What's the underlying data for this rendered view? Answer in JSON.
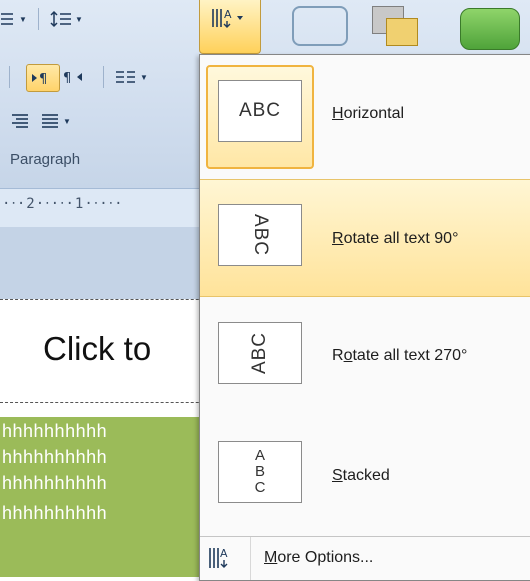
{
  "ribbon": {
    "group_label": "Paragraph",
    "ruler_text": "·‧·2·‧·‧·1·‧·‧·"
  },
  "slide": {
    "title_placeholder": "Click to",
    "green_lines": [
      "hhhhhhhhhh",
      "hhhhhhhhhh",
      "hhhhhhhhhh",
      "hhhhhhhhhh"
    ]
  },
  "text_direction_menu": {
    "items": [
      {
        "thumb": "ABC",
        "label_u": "H",
        "label_rest": "orizontal",
        "selected": true
      },
      {
        "thumb": "ABC",
        "label_u": "R",
        "label_rest": "otate all text 90°",
        "highlighted": true
      },
      {
        "thumb": "ABC",
        "label_pre": "R",
        "label_u": "o",
        "label_rest": "tate all text 270°"
      },
      {
        "thumb": "ABC",
        "label_u": "S",
        "label_rest": "tacked"
      }
    ],
    "more": {
      "label_u": "M",
      "label_rest": "ore Options..."
    }
  },
  "colors": {
    "highlight": "#ffe39a",
    "selected_border": "#f0b440",
    "slide_green": "#9bbb59",
    "ribbon_bg": "#d0ddee"
  }
}
